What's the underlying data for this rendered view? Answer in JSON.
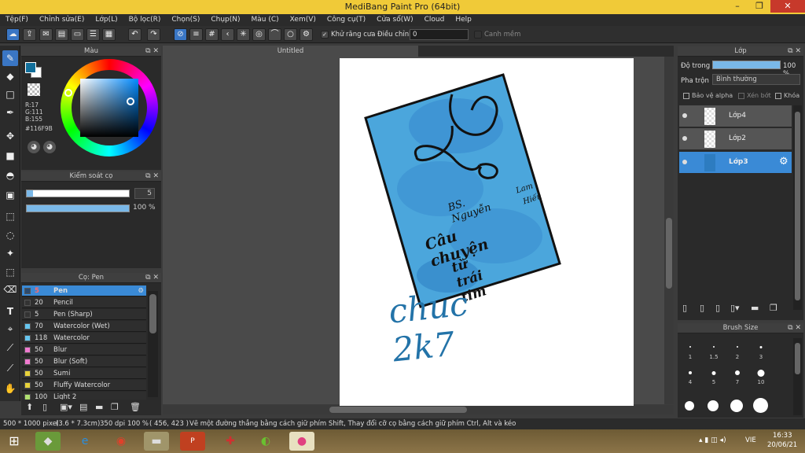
{
  "window": {
    "title": "MediBang Paint Pro (64bit)",
    "minimize": "–",
    "restore": "❐",
    "close": "✕"
  },
  "menu": [
    "Tệp(F)",
    "Chỉnh sửa(E)",
    "Lớp(L)",
    "Bộ lọc(R)",
    "Chọn(S)",
    "Chụp(N)",
    "Màu (C)",
    "Xem(V)",
    "Công cụ(T)",
    "Cửa sổ(W)",
    "Cloud",
    "Help"
  ],
  "toolbar": {
    "antialias": "Khử răng cưa",
    "adjust": "Điều chỉnh",
    "adjust_value": "0",
    "smooth": "Canh mềm"
  },
  "color_panel": {
    "title": "Màu",
    "r": "R:17",
    "g": "G:111",
    "b": "B:155",
    "hex": "#116F9B",
    "fg_color": "#116F9B"
  },
  "brush_control": {
    "title": "Kiểm soát cọ",
    "size": "5",
    "opacity": "100 %"
  },
  "brush_panel": {
    "title": "Cọ: Pen",
    "items": [
      {
        "size": "5",
        "name": "Pen",
        "color": "#2b4a6e",
        "selected": true
      },
      {
        "size": "20",
        "name": "Pencil",
        "color": "#333333"
      },
      {
        "size": "5",
        "name": "Pen (Sharp)",
        "color": "#333333"
      },
      {
        "size": "70",
        "name": "Watercolor (Wet)",
        "color": "#66c6f0"
      },
      {
        "size": "118",
        "name": "Watercolor",
        "color": "#66c6f0"
      },
      {
        "size": "50",
        "name": "Blur",
        "color": "#f07ad0"
      },
      {
        "size": "50",
        "name": "Blur (Soft)",
        "color": "#f07ad0"
      },
      {
        "size": "50",
        "name": "Sumi",
        "color": "#e8d23a"
      },
      {
        "size": "50",
        "name": "Fluffy Watercolor",
        "color": "#e8d23a"
      },
      {
        "size": "100",
        "name": "Light 2",
        "color": "#b0e070"
      }
    ]
  },
  "canvas": {
    "tab": "Untitled"
  },
  "artwork": {
    "line1": "BS. Nguyễn",
    "line1b": "Lam",
    "line1c": "Hiếu",
    "title1": "Câu chuyện",
    "title2": "từ trái tim",
    "signature": "chuc 2k7"
  },
  "layers_panel": {
    "title": "Lớp",
    "opacity_label": "Độ trong",
    "opacity_value": "100 %",
    "blend_label": "Pha trộn",
    "blend_value": "Bình thường",
    "protect_alpha": "Bảo vệ alpha",
    "clip": "Xén bớt",
    "lock": "Khóa",
    "layers": [
      {
        "name": "Lớp4",
        "selected": false
      },
      {
        "name": "Lớp2",
        "selected": false
      },
      {
        "name": "Lớp3",
        "selected": true
      }
    ]
  },
  "brush_size_panel": {
    "title": "Brush Size",
    "sizes": [
      "1",
      "1.5",
      "2",
      "3",
      "4",
      "5",
      "7",
      "10"
    ]
  },
  "status": {
    "dimensions": "500 * 1000 pixel",
    "physical": "(3.6 * 7.3cm)",
    "dpi": "350 dpi",
    "zoom": "100 %",
    "coords": "( 456, 423 )",
    "hint": "Vẽ một đường thẳng bằng cách giữ phím Shift, Thay đổi cỡ cọ bằng cách giữ phím Ctrl, Alt và kéo"
  },
  "taskbar": {
    "lang": "VIE",
    "time": "16:33",
    "date": "20/06/21"
  }
}
